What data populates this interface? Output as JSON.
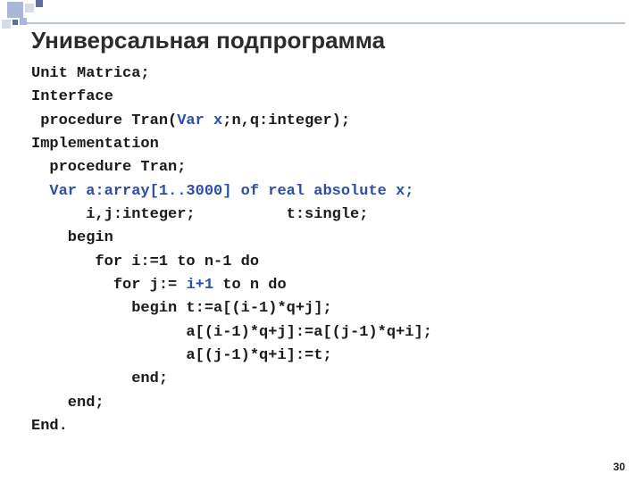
{
  "title": "Универсальная подпрограмма",
  "code": {
    "l1": "Unit Matrica;",
    "l2": "Interface",
    "l3a": " procedure Tran(",
    "l3b": "Var x",
    "l3c": ";n,q:integer);",
    "l4": "Implementation",
    "l5": "  procedure Tran;",
    "l6a": "  ",
    "l6b": "Var a:array[1..3000] of real absolute x;",
    "l7a": "      i,j:integer;          t:single;",
    "l8": "    begin",
    "l9": "       for i:=1 to n-1 do",
    "l10a": "         for j:= ",
    "l10b": "i+1",
    "l10c": " to n do",
    "l11": "           begin t:=a[(i-1)*q+j];",
    "l12": "                 a[(i-1)*q+j]:=a[(j-1)*q+i];",
    "l13": "                 a[(j-1)*q+i]:=t;",
    "l14": "           end;",
    "l15": "    end;",
    "l16": "End."
  },
  "page_number": "30"
}
